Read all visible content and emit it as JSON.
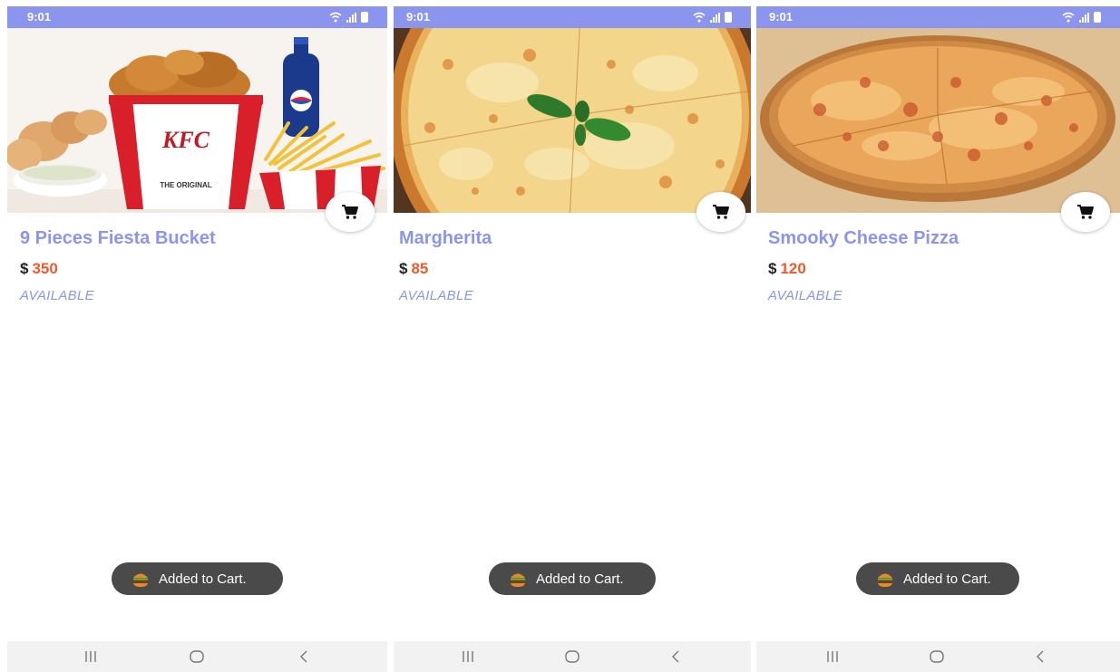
{
  "screens": [
    {
      "status": {
        "time": "9:01"
      },
      "item": {
        "name": "9 Pieces Fiesta Bucket",
        "currency": "$",
        "price": "350",
        "availability": "AVAILABLE",
        "image": "kfc-bucket-meal-photo"
      },
      "toast": {
        "message": "Added to Cart.",
        "icon": "burger-icon"
      }
    },
    {
      "status": {
        "time": "9:01"
      },
      "item": {
        "name": "Margherita",
        "currency": "$",
        "price": "85",
        "availability": "AVAILABLE",
        "image": "margherita-pizza-photo"
      },
      "toast": {
        "message": "Added to Cart.",
        "icon": "burger-icon"
      }
    },
    {
      "status": {
        "time": "9:01"
      },
      "item": {
        "name": "Smooky Cheese Pizza",
        "currency": "$",
        "price": "120",
        "availability": "AVAILABLE",
        "image": "cheese-pizza-photo"
      },
      "toast": {
        "message": "Added to Cart.",
        "icon": "burger-icon"
      }
    }
  ],
  "kfc_image": {
    "brand": "KFC",
    "tagline": "THE ORIGINAL"
  },
  "colors": {
    "accent": "#8b95ee",
    "price": "#ee5a2c",
    "toast_bg": "#4a4a4a",
    "statusbar": "#8b95ee"
  },
  "icons": {
    "cart": "shopping-cart-icon",
    "nav_recents": "recents-icon",
    "nav_home": "home-icon",
    "nav_back": "back-icon"
  }
}
